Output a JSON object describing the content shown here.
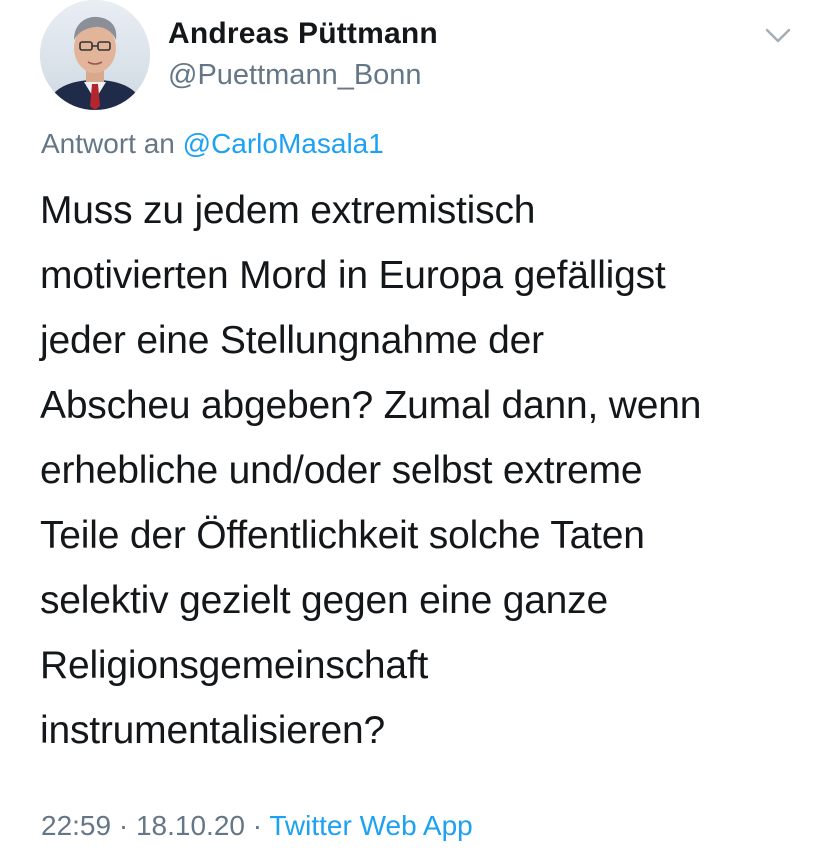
{
  "author": {
    "name": "Andreas Püttmann",
    "handle": "@Puettmann_Bonn",
    "avatar_icon": "profile-photo"
  },
  "reply_to": {
    "prefix": "Antwort an",
    "handle": "@CarloMasala1"
  },
  "tweet": {
    "lines": [
      "Muss zu jedem extremistisch",
      "motivierten Mord in Europa gefälligst",
      "jeder eine Stellungnahme der",
      "Abscheu abgeben? Zumal dann, wenn",
      "erhebliche und/oder selbst extreme",
      "Teile der Öffentlichkeit solche Taten",
      "selektiv gezielt gegen eine ganze",
      "Religionsgemeinschaft",
      "instrumentalisieren?"
    ]
  },
  "meta": {
    "time": "22:59",
    "separator": "·",
    "date": "18.10.20",
    "source": "Twitter Web App"
  },
  "colors": {
    "link": "#1da1f2",
    "secondary_text": "#657786",
    "primary_text": "#14171a"
  },
  "icons": {
    "menu": "chevron-down-icon"
  }
}
